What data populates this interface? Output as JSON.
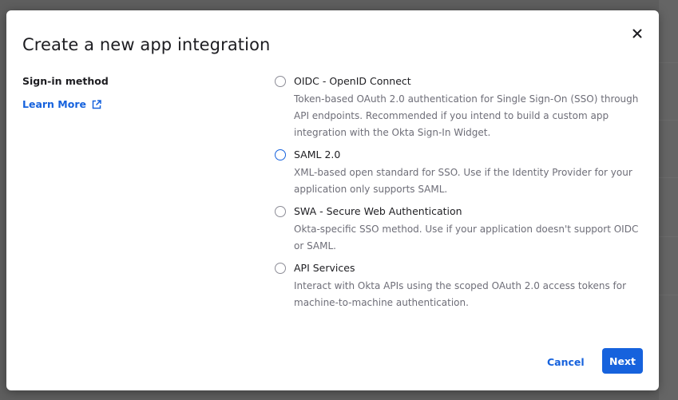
{
  "modal": {
    "title": "Create a new app integration",
    "close_icon": "close-icon",
    "section_label": "Sign-in method",
    "learn_more": {
      "label": "Learn More",
      "icon": "external-link-icon"
    },
    "options": [
      {
        "title": "OIDC - OpenID Connect",
        "description": "Token-based OAuth 2.0 authentication for Single Sign-On (SSO) through API endpoints. Recommended if you intend to build a custom app integration with the Okta Sign-In Widget.",
        "selected": false,
        "focused": false
      },
      {
        "title": "SAML 2.0",
        "description": "XML-based open standard for SSO. Use if the Identity Provider for your application only supports SAML.",
        "selected": false,
        "focused": true
      },
      {
        "title": "SWA - Secure Web Authentication",
        "description": "Okta-specific SSO method. Use if your application doesn't support OIDC or SAML.",
        "selected": false,
        "focused": false
      },
      {
        "title": "API Services",
        "description": "Interact with Okta APIs using the scoped OAuth 2.0 access tokens for machine-to-machine authentication.",
        "selected": false,
        "focused": false
      }
    ],
    "buttons": {
      "cancel": "Cancel",
      "next": "Next"
    }
  },
  "colors": {
    "accent": "#1662dd",
    "overlay": "#5e5e5e",
    "text_primary": "#1d1d21",
    "text_secondary": "#6e6e78"
  }
}
